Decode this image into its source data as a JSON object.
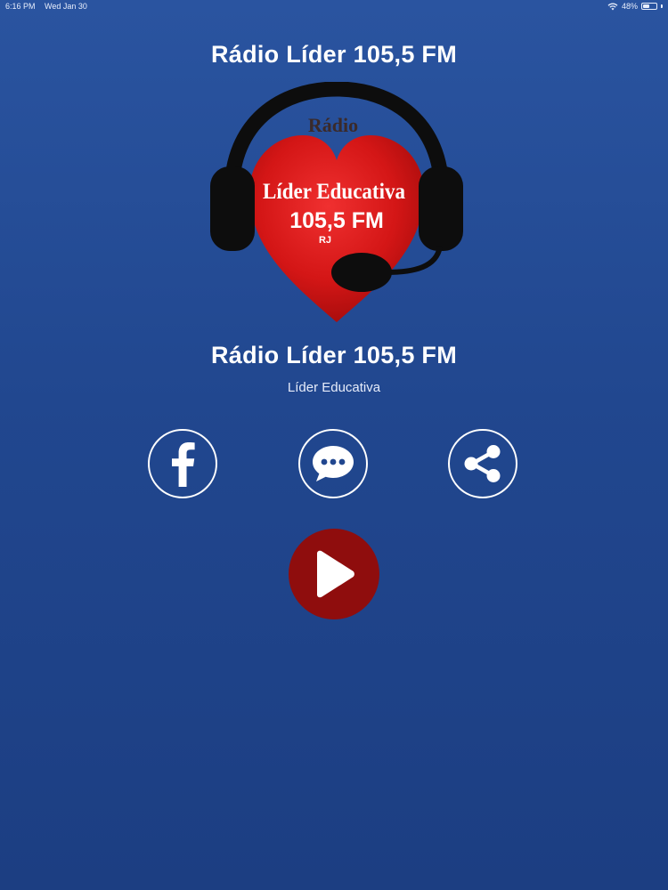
{
  "status_bar": {
    "time": "6:16 PM",
    "date": "Wed Jan 30",
    "battery": "48%",
    "battery_level": 0.48
  },
  "header": {
    "title": "Rádio Líder 105,5 FM"
  },
  "logo": {
    "line1": "Rádio",
    "line2": "Líder Educativa",
    "line3": "105,5 FM",
    "line4": "RJ"
  },
  "station": {
    "name": "Rádio Líder 105,5 FM",
    "subtitle": "Líder Educativa"
  },
  "actions": {
    "facebook_icon": "facebook-icon",
    "chat_icon": "chat-bubble-icon",
    "share_icon": "share-icon",
    "play_icon": "play-icon"
  },
  "colors": {
    "background_top": "#2a54a0",
    "background_bottom": "#1c3e82",
    "play_button": "#8f0d0d",
    "heart": "#d81818"
  }
}
